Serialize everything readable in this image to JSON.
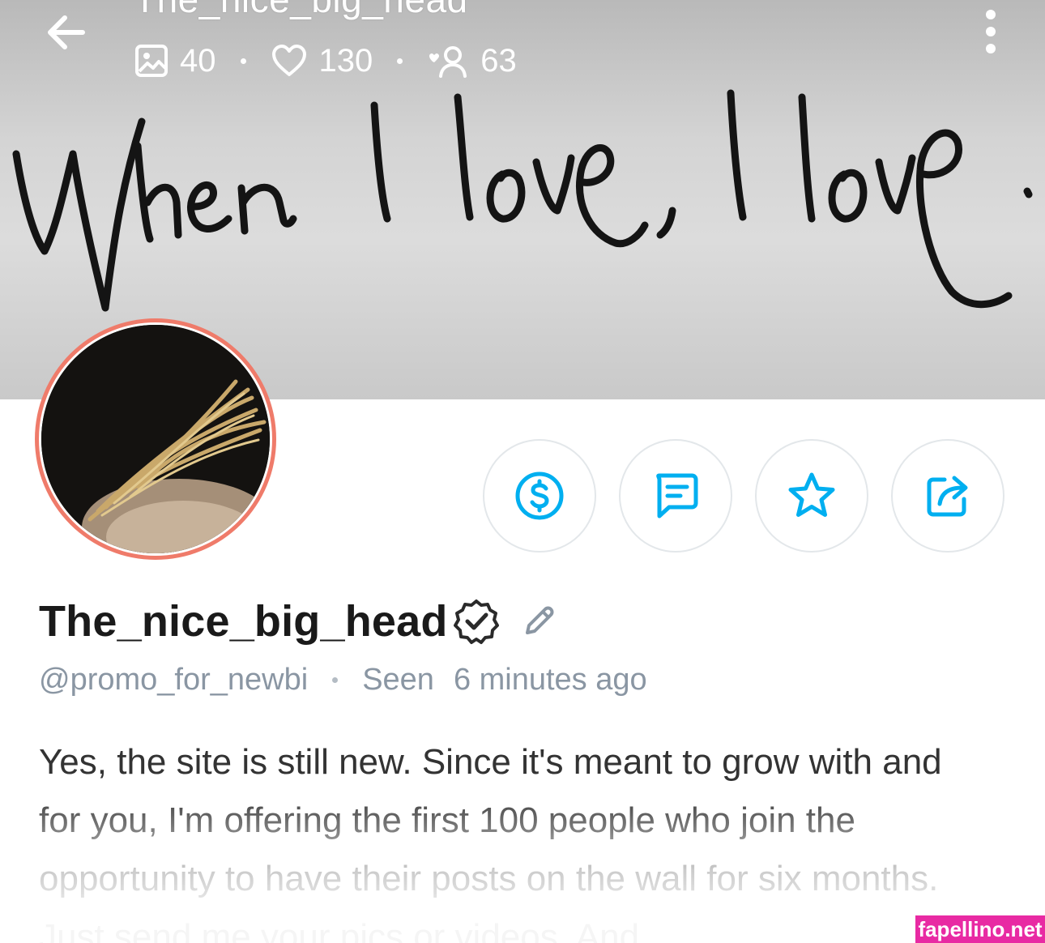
{
  "header": {
    "title": "The_nice_big_head",
    "back_icon": "arrow-left-icon",
    "more_icon": "vertical-dots-icon",
    "stats": {
      "media_count": "40",
      "likes_count": "130",
      "fans_count": "63"
    }
  },
  "cover": {
    "handwriting": "When I love, I love."
  },
  "actions": [
    {
      "name": "tip",
      "icon": "dollar-circle-icon"
    },
    {
      "name": "message",
      "icon": "message-icon"
    },
    {
      "name": "favorite",
      "icon": "star-icon"
    },
    {
      "name": "share",
      "icon": "share-icon"
    }
  ],
  "profile": {
    "display_name": "The_nice_big_head",
    "handle": "@promo_for_newbi",
    "seen_label": "Seen",
    "seen_time": "6 minutes ago",
    "bio": "Yes, the site is still new. Since it's meant to grow with and for you, I'm offering the first 100 people who join the opportunity to have their posts on the wall for six months. Just send me your pics or videos. And"
  },
  "watermark": "fapellino.net",
  "colors": {
    "accent": "#00aff0",
    "avatar_ring": "#ef7b6a",
    "muted_text": "#8a96a3",
    "watermark_bg": "#e82aa3"
  }
}
